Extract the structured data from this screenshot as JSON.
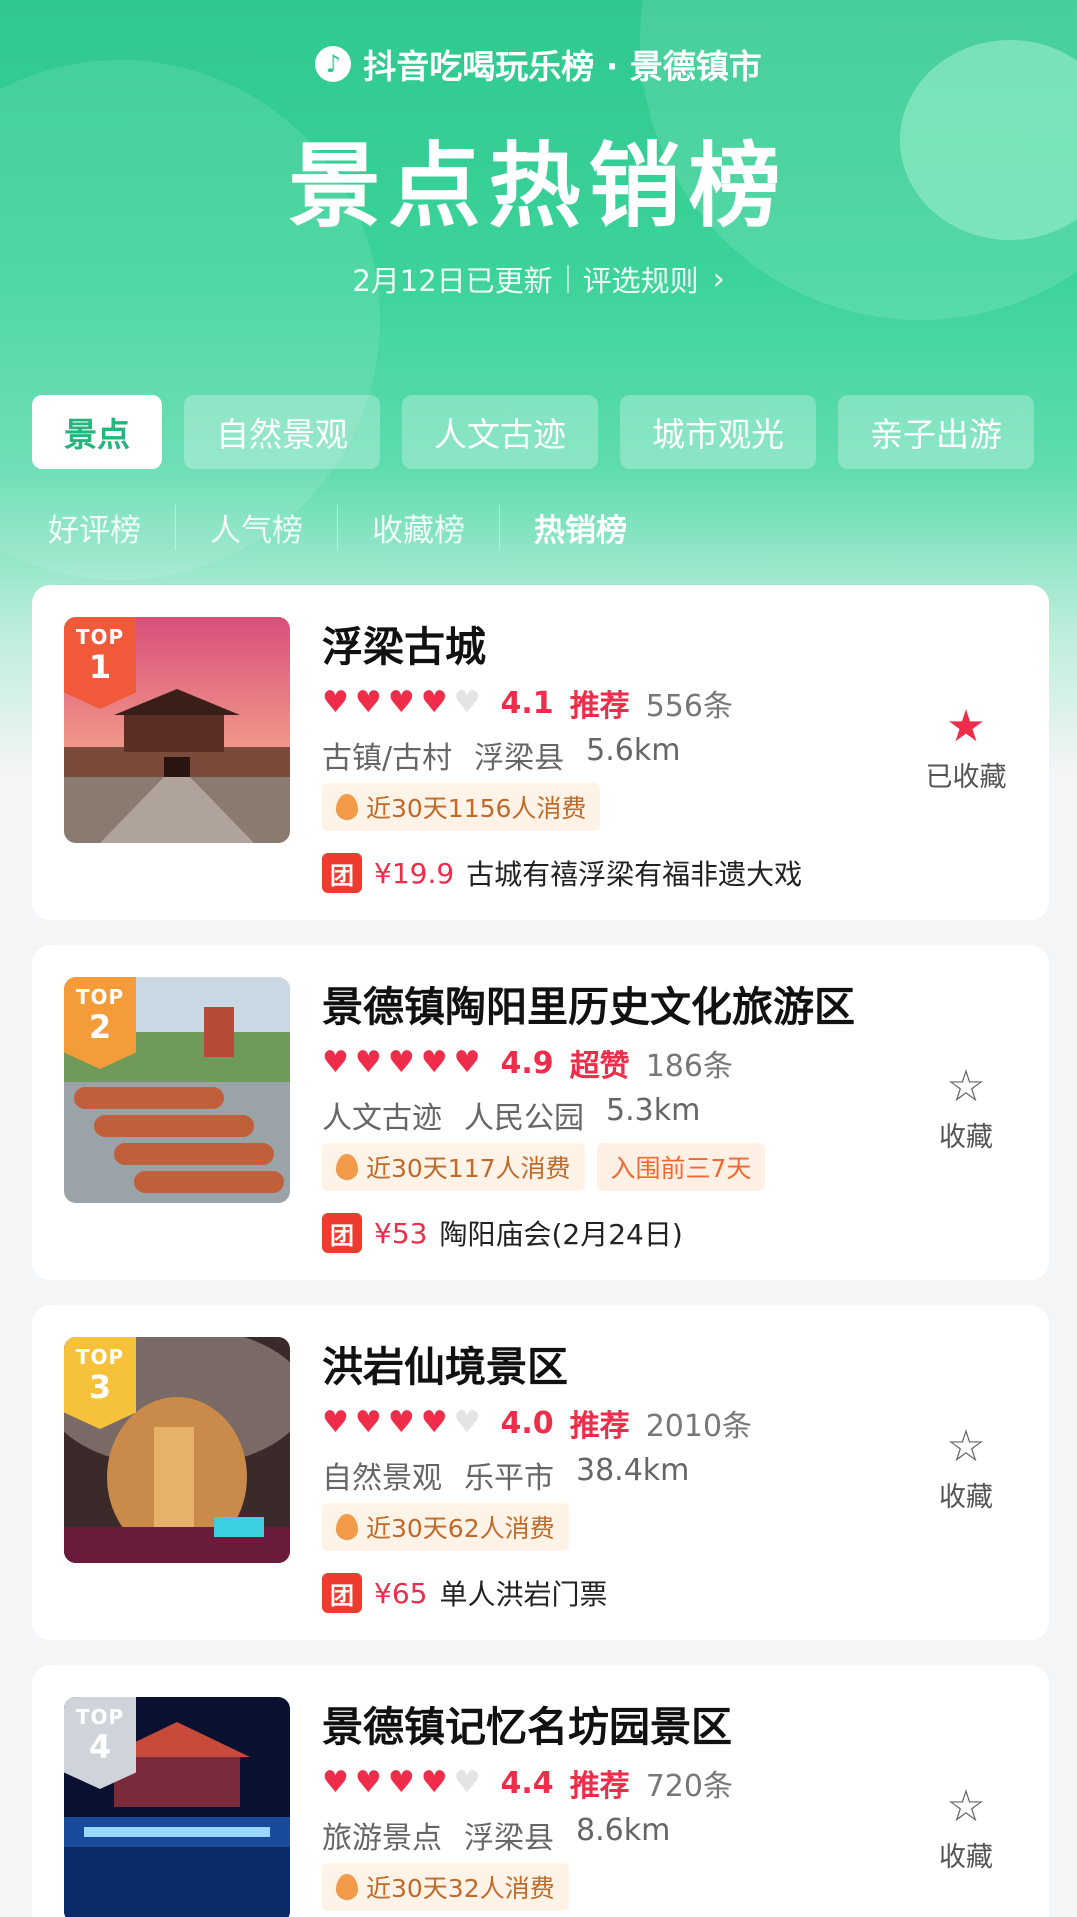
{
  "header": {
    "brand": "抖音吃喝玩乐榜 · 景德镇市",
    "title": "景点热销榜",
    "updated": "2月12日已更新",
    "rules_link": "评选规则"
  },
  "tabs": [
    {
      "label": "景点",
      "active": true
    },
    {
      "label": "自然景观",
      "active": false
    },
    {
      "label": "人文古迹",
      "active": false
    },
    {
      "label": "城市观光",
      "active": false
    },
    {
      "label": "亲子出游",
      "active": false
    }
  ],
  "subtabs": [
    {
      "label": "好评榜",
      "active": false
    },
    {
      "label": "人气榜",
      "active": false
    },
    {
      "label": "收藏榜",
      "active": false
    },
    {
      "label": "热销榜",
      "active": true
    }
  ],
  "list": [
    {
      "rank_top": "TOP",
      "rank": "1",
      "name": "浮梁古城",
      "hearts_filled": 4,
      "score": "4.1",
      "rating_label": "推荐",
      "reviews": "556条",
      "category": "古镇/古村",
      "district": "浮梁县",
      "distance": "5.6km",
      "sales": "近30天1156人消费",
      "extra_chip": "",
      "deal_tag": "团",
      "price": "¥19.9",
      "deal": "古城有禧浮梁有福非遗大戏",
      "favorited": true,
      "fav_label": "已收藏"
    },
    {
      "rank_top": "TOP",
      "rank": "2",
      "name": "景德镇陶阳里历史文化旅游区",
      "hearts_filled": 5,
      "score": "4.9",
      "rating_label": "超赞",
      "reviews": "186条",
      "category": "人文古迹",
      "district": "人民公园",
      "distance": "5.3km",
      "sales": "近30天117人消费",
      "extra_chip": "入围前三7天",
      "deal_tag": "团",
      "price": "¥53",
      "deal": "陶阳庙会(2月24日)",
      "favorited": false,
      "fav_label": "收藏"
    },
    {
      "rank_top": "TOP",
      "rank": "3",
      "name": "洪岩仙境景区",
      "hearts_filled": 4,
      "score": "4.0",
      "rating_label": "推荐",
      "reviews": "2010条",
      "category": "自然景观",
      "district": "乐平市",
      "distance": "38.4km",
      "sales": "近30天62人消费",
      "extra_chip": "",
      "deal_tag": "团",
      "price": "¥65",
      "deal": "单人洪岩门票",
      "favorited": false,
      "fav_label": "收藏"
    },
    {
      "rank_top": "TOP",
      "rank": "4",
      "name": "景德镇记忆名坊园景区",
      "hearts_filled": 4,
      "score": "4.4",
      "rating_label": "推荐",
      "reviews": "720条",
      "category": "旅游景点",
      "district": "浮梁县",
      "distance": "8.6km",
      "sales": "近30天32人消费",
      "extra_chip": "",
      "deal_tag": "",
      "price": "",
      "deal": "",
      "favorited": false,
      "fav_label": "收藏"
    }
  ]
}
